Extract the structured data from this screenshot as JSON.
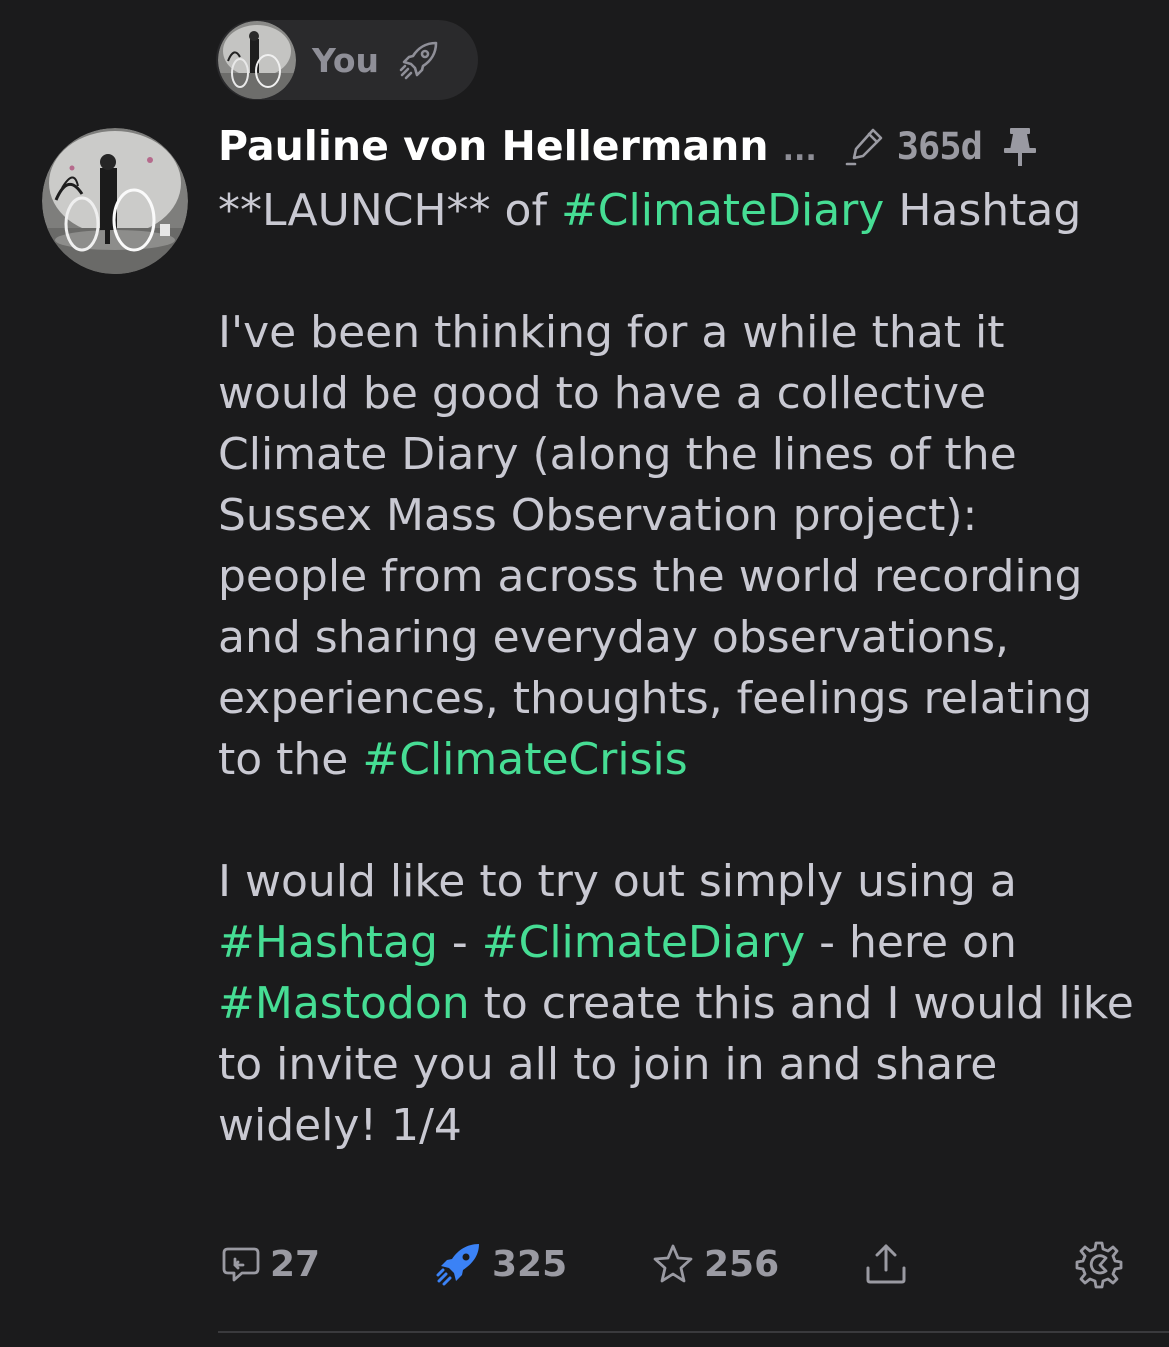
{
  "boost": {
    "label": "You",
    "icon": "rocket-outline-icon"
  },
  "post": {
    "author_name": "Pauline von Hellermann",
    "truncation": "...",
    "edited_icon": "pencil-icon",
    "timestamp": "365d",
    "pin_icon": "pin-icon",
    "paragraph1": {
      "prefix": "**LAUNCH**  of ",
      "hashtag": "#ClimateDiary",
      "suffix": " Hashtag"
    },
    "paragraph2": {
      "text": "I've been thinking for a while that it would be good to have a collective Climate Diary (along the lines of the Sussex Mass Observation project): people from across the world recording and sharing everyday observations, experiences, thoughts, feelings relating to the ",
      "hashtag": "#ClimateCrisis"
    },
    "paragraph3": {
      "intro": "I would like to try out simply using a ",
      "hashtag1": "#Hashtag",
      "sep1": " - ",
      "hashtag2": "#ClimateDiary",
      "sep2": " -  here on ",
      "hashtag3": "#Mastodon",
      "outro": " to create this and I would like to invite you all to join in and share widely! 1/4"
    }
  },
  "actions": {
    "reply": {
      "icon": "reply-bubble-icon",
      "count": "27"
    },
    "boost": {
      "icon": "rocket-icon",
      "count": "325",
      "active_color": "#3b82f6"
    },
    "favourite": {
      "icon": "star-icon",
      "count": "256"
    },
    "share": {
      "icon": "share-icon"
    },
    "more": {
      "icon": "gear-icon"
    }
  },
  "colors": {
    "background": "#1b1b1c",
    "hashtag": "#46dd94",
    "boosted": "#3b82f6"
  }
}
